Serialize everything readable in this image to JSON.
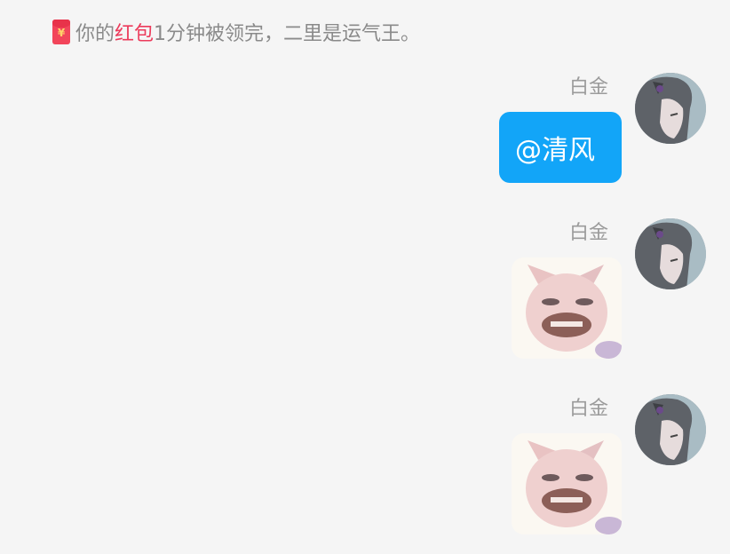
{
  "system_notice": {
    "icon": "red-packet-icon",
    "prefix": "你的",
    "link": "红包",
    "suffix": "1分钟被领完，二里是运气王。"
  },
  "messages": [
    {
      "sender": "白金",
      "type": "text",
      "text": "@清风",
      "avatar_icon": "anime-girl-avatar"
    },
    {
      "sender": "白金",
      "type": "sticker",
      "sticker_icon": "cat-face-sticker",
      "avatar_icon": "anime-girl-avatar"
    },
    {
      "sender": "白金",
      "type": "sticker",
      "sticker_icon": "cat-face-sticker",
      "avatar_icon": "anime-girl-avatar"
    }
  ],
  "colors": {
    "background": "#f5f5f5",
    "bubble": "#12a5f8",
    "highlight": "#ec3b5b",
    "meta_text": "#9b9b9b"
  }
}
